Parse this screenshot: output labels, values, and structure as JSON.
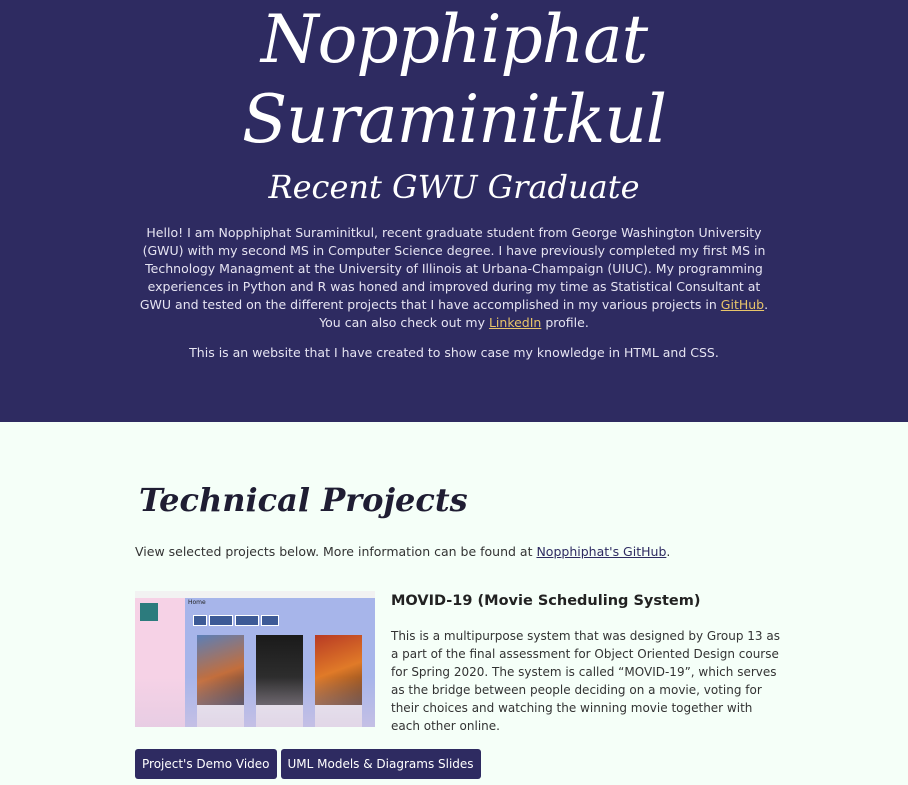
{
  "hero": {
    "name_line1": "Nopphiphat",
    "name_line2": "Suraminitkul",
    "subtitle": "Recent GWU Graduate",
    "intro_part1": "Hello! I am Nopphiphat Suraminitkul, recent graduate student from George Washington University (GWU) with my second MS in Computer Science degree. I have previously completed my first MS in Technology Managment at the University of Illinois at Urbana-Champaign (UIUC). My programming experiences in Python and R was honed and improved during my time as Statistical Consultant at GWU and tested on the different projects that I have accomplished in my various projects in ",
    "github_link": "GitHub",
    "intro_part2": ". You can also check out my ",
    "linkedin_link": "LinkedIn",
    "intro_part3": " profile.",
    "showcase": "This is an website that I have created to show case my knowledge in HTML and CSS."
  },
  "projects_section": {
    "title": "Technical Projects",
    "intro_text": "View selected projects below. More information can be found at ",
    "github_link": "Nopphiphat's GitHub",
    "intro_end": "."
  },
  "project": {
    "title": "MOVID-19 (Movie Scheduling System)",
    "description": "This is a multipurpose system that was designed by Group 13 as a part of the final assessment for Object Oriented Design course for Spring 2020. The system is called “MOVID-19”, which serves as the bridge between people deciding on a movie, voting for their choices and watching the winning movie together with each other online.",
    "thumbnail_label": "Home",
    "buttons": [
      "Project's Demo Video",
      "UML Models & Diagrams Slides"
    ]
  },
  "colors": {
    "hero_bg": "#2e2b61",
    "page_bg": "#f5fff8",
    "link_accent": "#e8c56a",
    "button_bg": "#2e2b61"
  }
}
